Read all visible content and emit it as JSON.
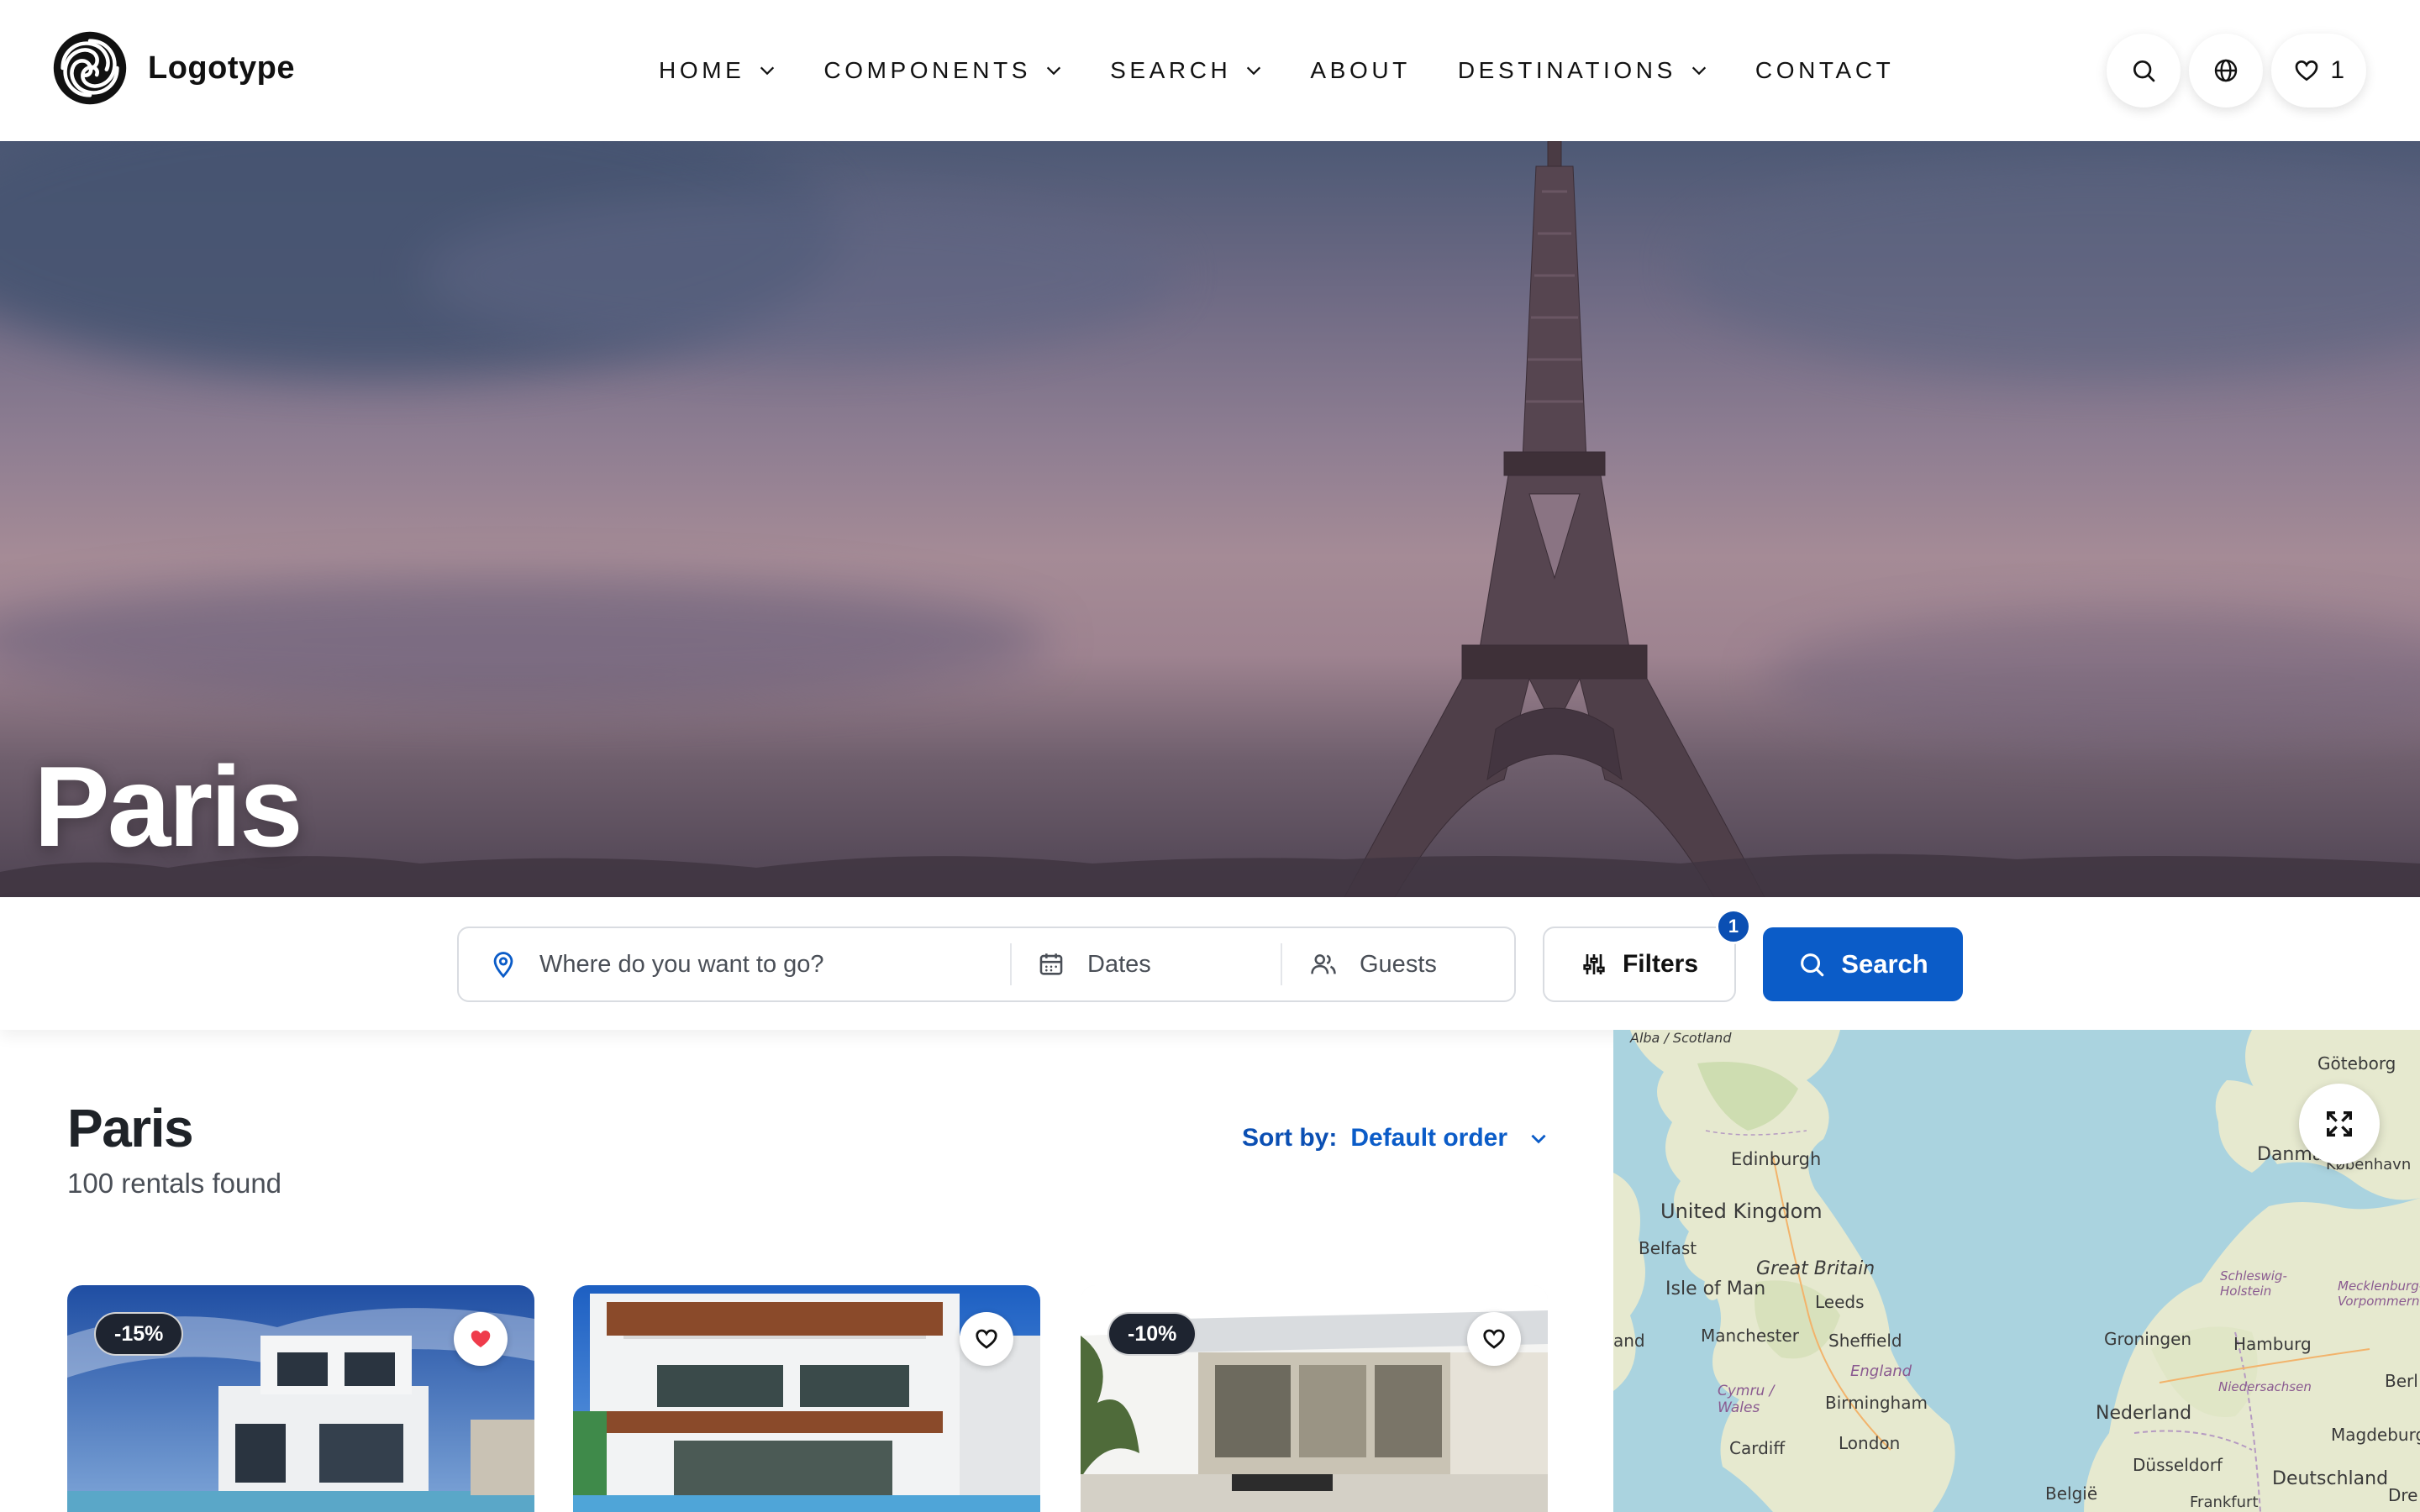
{
  "header": {
    "logo_text": "Logotype",
    "nav": [
      {
        "label": "HOME",
        "has_dropdown": true
      },
      {
        "label": "COMPONENTS",
        "has_dropdown": true
      },
      {
        "label": "SEARCH",
        "has_dropdown": true
      },
      {
        "label": "ABOUT",
        "has_dropdown": false
      },
      {
        "label": "DESTINATIONS",
        "has_dropdown": true
      },
      {
        "label": "CONTACT",
        "has_dropdown": false
      }
    ],
    "favorites_count": "1",
    "icons": [
      "search-icon",
      "globe-icon",
      "heart-icon"
    ]
  },
  "hero": {
    "title": "Paris"
  },
  "search": {
    "where_placeholder": "Where do you want to go?",
    "dates_placeholder": "Dates",
    "guests_placeholder": "Guests",
    "filters_label": "Filters",
    "filters_badge": "1",
    "search_label": "Search"
  },
  "results": {
    "title": "Paris",
    "count_text": "100 rentals found",
    "sort_label": "Sort by:",
    "sort_value": "Default order"
  },
  "listings": [
    {
      "discount": "-15%",
      "favorited": true
    },
    {
      "discount": "",
      "favorited": false
    },
    {
      "discount": "-10%",
      "favorited": false
    }
  ],
  "map": {
    "labels": [
      "Alba / Scotland",
      "Edinburgh",
      "United Kingdom",
      "Belfast",
      "Isle of Man",
      "Great Britain",
      "Leeds",
      "Manchester",
      "Sheffield",
      "England",
      "Cymru / Wales",
      "Birmingham",
      "Cardiff",
      "London",
      "Göteborg",
      "Danmark",
      "København",
      "Schleswig-Holstein",
      "Mecklenburg-Vorpommern",
      "Groningen",
      "Hamburg",
      "Niedersachsen",
      "Nederland",
      "Magdeburg",
      "Düsseldorf",
      "Deutschland",
      "België",
      "Frankfurt",
      "Berl",
      "Dre",
      "and"
    ]
  },
  "colors": {
    "primary": "#0b5cc8",
    "badge": "#0b4fb3",
    "discount_bg": "#1e2430",
    "favorite_red": "#ef3b4b",
    "map_water": "#aad3df",
    "map_land": "#e8ead2"
  }
}
